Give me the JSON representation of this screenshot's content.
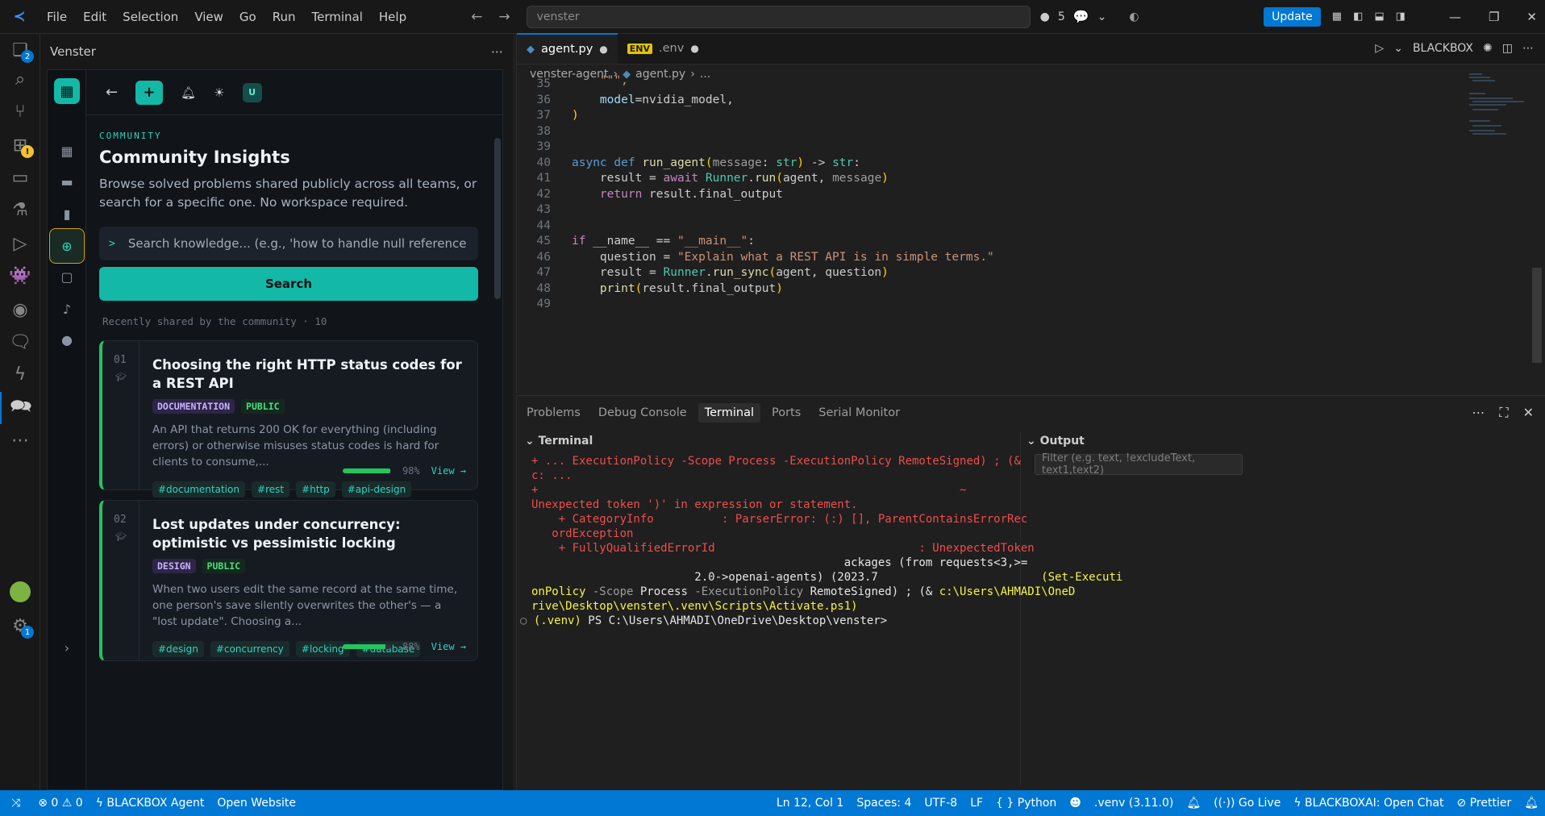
{
  "titlebar": {
    "menu": [
      "File",
      "Edit",
      "Selection",
      "View",
      "Go",
      "Run",
      "Terminal",
      "Help"
    ],
    "search": "venster",
    "changes_count": "5",
    "update_label": "Update"
  },
  "activity_badges": {
    "explorer": "2",
    "settings": "1"
  },
  "sidebar": {
    "title": "Venster",
    "user_initial": "U",
    "community": {
      "eyebrow": "COMMUNITY",
      "title": "Community Insights",
      "subtitle": "Browse solved problems shared publicly across all teams, or search for a specific one. No workspace required.",
      "search_placeholder": "Search knowledge... (e.g., 'how to handle null references')",
      "search_button": "Search",
      "recent_label": "Recently shared by the community · 10",
      "cards": [
        {
          "num": "01",
          "title": "Choosing the right HTTP status codes for a REST API",
          "category": "DOCUMENTATION",
          "visibility": "PUBLIC",
          "desc": "An API that returns 200 OK for everything (including errors) or otherwise misuses status codes is hard for clients to consume,...",
          "tags": [
            "#documentation",
            "#rest",
            "#http",
            "#api-design"
          ],
          "score": 98,
          "score_label": "98%",
          "view": "View →"
        },
        {
          "num": "02",
          "title": "Lost updates under concurrency: optimistic vs pessimistic locking",
          "category": "DESIGN",
          "visibility": "PUBLIC",
          "desc": "When two users edit the same record at the same time, one person's save silently overwrites the other's — a \"lost update\". Choosing a...",
          "tags": [
            "#design",
            "#concurrency",
            "#locking",
            "#database"
          ],
          "score": 88,
          "score_label": "88%",
          "view": "View →"
        }
      ]
    }
  },
  "editor": {
    "tabs": [
      {
        "name": "agent.py",
        "active": true
      },
      {
        "name": ".env",
        "active": false
      }
    ],
    "right_label": "BLACKBOX",
    "breadcrumb": [
      "venster-agent",
      "agent.py",
      "..."
    ],
    "line_numbers": [
      "35",
      "36",
      "37",
      "38",
      "39",
      "40",
      "41",
      "42",
      "43",
      "44",
      "45",
      "46",
      "47",
      "48",
      "49"
    ]
  },
  "panel": {
    "tabs": [
      "Problems",
      "Debug Console",
      "Terminal",
      "Ports",
      "Serial Monitor"
    ],
    "terminal_header": "Terminal",
    "output_header": "Output",
    "filter_placeholder": "Filter (e.g. text, !excludeText, text1,text2)",
    "terminal_lines": [
      "+ ... ExecutionPolicy -Scope Process -ExecutionPolicy RemoteSigned) ; (&",
      "c: ...",
      "+                                                              ~",
      "Unexpected token ')' in expression or statement.",
      "    + CategoryInfo          : ParserError: (:) [], ParentContainsErrorRec",
      "   ordException",
      "    + FullyQualifiedErrorId                              : UnexpectedToken",
      "                                              ackages (from requests<3,>=",
      "                        2.0->openai-agents) (2023.7"
    ],
    "terminal_mixed_1a": "                        (Set-Executi",
    "terminal_mixed_2a": "onPolicy ",
    "terminal_mixed_2b": "-Scope",
    "terminal_mixed_2c": " Process ",
    "terminal_mixed_2d": "-ExecutionPolicy",
    "terminal_mixed_2e": " RemoteSigned) ; (& ",
    "terminal_mixed_2f": "c:\\Users\\AHMADI\\OneD",
    "terminal_mixed_3": "rive\\Desktop\\venster\\.venv\\Scripts\\Activate.ps1)",
    "prompt_venv": "(.venv)",
    "prompt": " PS C:\\Users\\AHMADI\\OneDrive\\Desktop\\venster>"
  },
  "statusbar": {
    "errors": "0",
    "warnings": "0",
    "blackbox_agent": "BLACKBOX Agent",
    "open_website": "Open Website",
    "position": "Ln 12, Col 1",
    "spaces": "Spaces: 4",
    "encoding": "UTF-8",
    "eol": "LF",
    "language": "Python",
    "interpreter": ".venv (3.11.0)",
    "go_live": "Go Live",
    "blackbox_chat": "BLACKBOXAI: Open Chat",
    "prettier": "Prettier"
  },
  "colors": {
    "accent": "#0078d4",
    "teal": "#14b8a6",
    "green": "#22c55e"
  }
}
